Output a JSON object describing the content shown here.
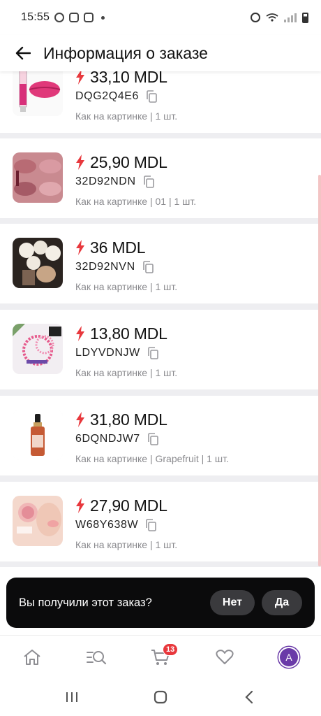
{
  "status_bar": {
    "time": "15:55"
  },
  "header": {
    "title": "Информация о заказе"
  },
  "items": [
    {
      "price": "33,10 MDL",
      "code": "DQG2Q4E6",
      "variant": "Как на картинке | 1 шт."
    },
    {
      "price": "25,90 MDL",
      "code": "32D92NDN",
      "variant": "Как на картинке | 01 | 1 шт."
    },
    {
      "price": "36 MDL",
      "code": "32D92NVN",
      "variant": "Как на картинке | 1 шт."
    },
    {
      "price": "13,80 MDL",
      "code": "LDYVDNJW",
      "variant": "Как на картинке | 1 шт."
    },
    {
      "price": "31,80 MDL",
      "code": "6DQNDJW7",
      "variant": "Как на картинке | Grapefruit | 1 шт."
    },
    {
      "price": "27,90 MDL",
      "code": "W68Y638W",
      "variant": "Как на картинке | 1 шт."
    }
  ],
  "confirm": {
    "question": "Вы получили этот заказ?",
    "no_label": "Нет",
    "yes_label": "Да"
  },
  "bottom_nav": {
    "cart_count": "13",
    "avatar_letter": "A"
  },
  "colors": {
    "accent": "#e8383d",
    "banner": "#0b0b0c",
    "muted": "#8a8a8e"
  }
}
